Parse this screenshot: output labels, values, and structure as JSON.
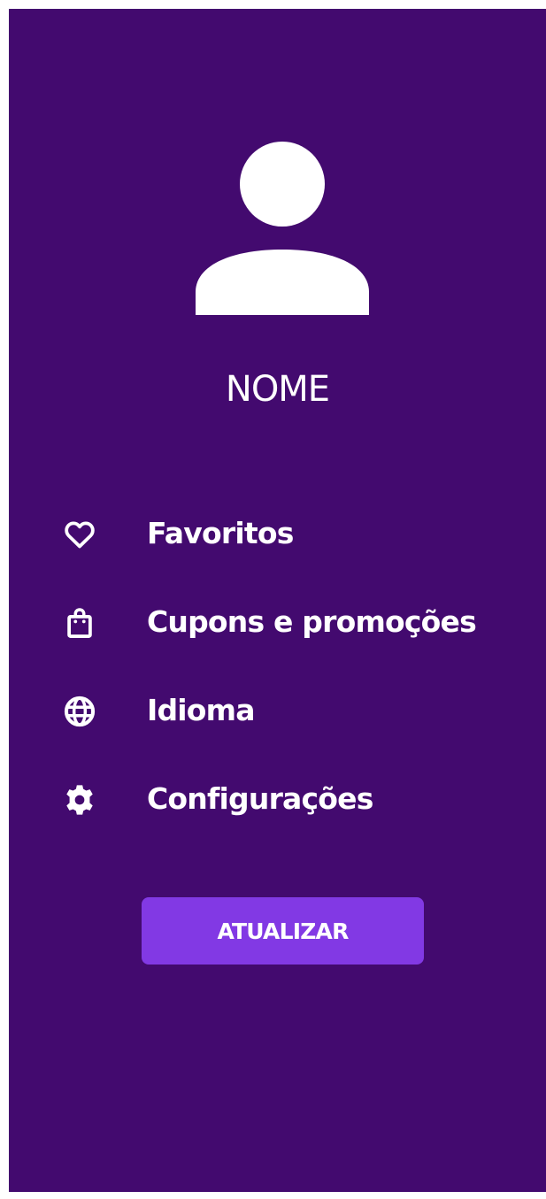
{
  "profile": {
    "name": "NOME"
  },
  "menu": {
    "items": [
      {
        "label": "Favoritos",
        "icon": "heart-icon"
      },
      {
        "label": "Cupons e promoções",
        "icon": "shopping-bag-icon"
      },
      {
        "label": "Idioma",
        "icon": "globe-icon"
      },
      {
        "label": "Configurações",
        "icon": "gear-icon"
      }
    ]
  },
  "actions": {
    "update_label": "ATUALIZAR"
  },
  "colors": {
    "background": "#430a6f",
    "button": "#8239e4",
    "text": "#ffffff"
  }
}
